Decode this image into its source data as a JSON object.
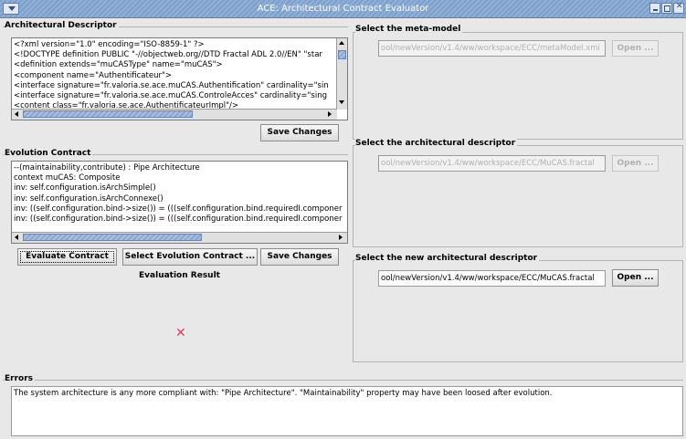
{
  "window": {
    "title": "ACE: Architectural Contract Evaluator"
  },
  "descriptor": {
    "label": "Architectural Descriptor",
    "lines": [
      "<?xml version=\"1.0\" encoding=\"ISO-8859-1\" ?>",
      "<!DOCTYPE definition PUBLIC \"-//objectweb.org//DTD Fractal ADL 2.0//EN\" \"star",
      "<definition extends=\"muCASType\" name=\"muCAS\">",
      "  <component name=\"Authentificateur\">",
      "    <interface signature=\"fr.valoria.se.ace.muCAS.Authentification\" cardinality=\"sin",
      "    <interface signature=\"fr.valoria.se.ace.muCAS.ControleAcces\" cardinality=\"sing",
      "    <content class=\"fr.valoria.se.ace.AuthentificateurImpl\"/>"
    ],
    "save_label": "Save Changes"
  },
  "contract": {
    "label": "Evolution Contract",
    "lines": [
      "--(maintainability,contribute) : Pipe Architecture",
      "context muCAS: Composite",
      "inv: self.configuration.isArchSimple()",
      "inv: self.configuration.isArchConnexe()",
      "inv: ((self.configuration.bind->size()) = (((self.configuration.bind.requiredI.componer",
      "inv: ((self.configuration.bind->size()) = (((self.configuration.bind.requiredI.componer"
    ],
    "evaluate_label": "Evaluate Contract",
    "select_label": "Select Evolution Contract ...",
    "save_label": "Save Changes"
  },
  "result": {
    "label": "Evaluation Result",
    "icon": "cross-icon",
    "icon_glyph": "✕",
    "icon_color": "#d04060"
  },
  "metamodel": {
    "label": "Select the meta-model",
    "path": "ool/newVersion/v1.4/ww/workspace/ECC/metaModel.xmi",
    "open_label": "Open ..."
  },
  "arch_descriptor": {
    "label": "Select the architectural descriptor",
    "path": "ool/newVersion/v1.4/ww/workspace/ECC/MuCAS.fractal",
    "open_label": "Open ..."
  },
  "new_descriptor": {
    "label": "Select the new architectural descriptor",
    "path": "ool/newVersion/v1.4/ww/workspace/ECC/MuCAS.fractal",
    "open_label": "Open ..."
  },
  "errors": {
    "label": "Errors",
    "message": "The system architecture is any more compliant with: \"Pipe Architecture\". \"Maintainability\" property may have been loosed after evolution."
  }
}
